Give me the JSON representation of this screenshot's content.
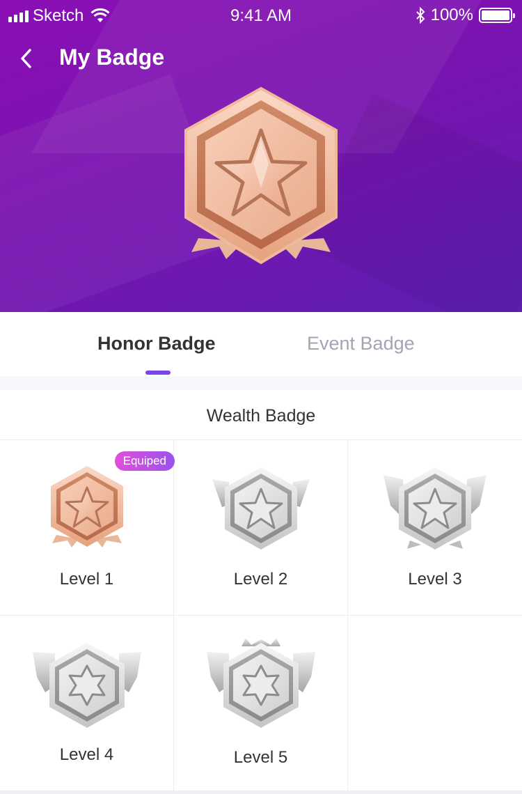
{
  "status_bar": {
    "carrier": "Sketch",
    "time": "9:41 AM",
    "battery": "100%"
  },
  "nav": {
    "title": "My Badge",
    "back_icon": "chevron-left-icon"
  },
  "hero": {
    "badge_icon": "bronze-star-hexagon-badge"
  },
  "tabs": [
    {
      "label": "Honor Badge",
      "active": true
    },
    {
      "label": "Event Badge",
      "active": false
    }
  ],
  "section": {
    "title": "Wealth Badge",
    "items": [
      {
        "label": "Level 1",
        "tier": "bronze",
        "tag": "Equiped"
      },
      {
        "label": "Level 2",
        "tier": "silver"
      },
      {
        "label": "Level 3",
        "tier": "silver-wings"
      },
      {
        "label": "Level 4",
        "tier": "silver-wings-star6"
      },
      {
        "label": "Level 5",
        "tier": "silver-crown-star6"
      }
    ]
  },
  "colors": {
    "header_gradient_start": "#8a0fb5",
    "header_gradient_end": "#5c1fb0",
    "tab_indicator": "#7a46e6",
    "tag_gradient_start": "#e14fd9",
    "tag_gradient_end": "#9a52ef",
    "bronze": "#e8a886",
    "silver": "#c9c9c9"
  }
}
